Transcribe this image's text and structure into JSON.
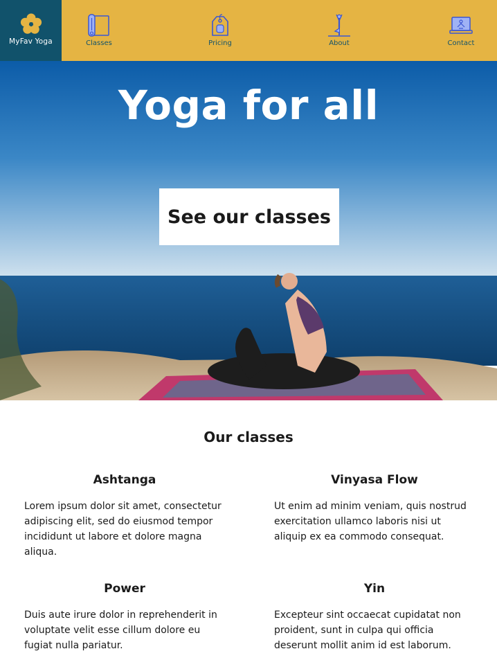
{
  "header": {
    "logo": {
      "text": "MyFav Yoga",
      "icon": "flower-icon"
    },
    "nav": [
      {
        "label": "Classes",
        "icon": "yoga-mat-icon"
      },
      {
        "label": "Pricing",
        "icon": "price-tag-icon"
      },
      {
        "label": "About",
        "icon": "tree-pose-icon"
      },
      {
        "label": "Contact",
        "icon": "laptop-icon"
      }
    ]
  },
  "hero": {
    "title": "Yoga for all",
    "cta_label": "See our classes"
  },
  "classes": {
    "title": "Our classes",
    "items": [
      {
        "name": "Ashtanga",
        "description": "Lorem ipsum dolor sit amet, consectetur adipiscing elit, sed do eiusmod tempor incididunt ut labore et dolore magna aliqua."
      },
      {
        "name": "Vinyasa Flow",
        "description": "Ut enim ad minim veniam, quis nostrud exercitation ullamco laboris nisi ut aliquip ex ea commodo consequat."
      },
      {
        "name": "Power",
        "description": "Duis aute irure dolor in reprehenderit in voluptate velit esse cillum dolore eu fugiat nulla pariatur."
      },
      {
        "name": "Yin",
        "description": "Excepteur sint occaecat cupidatat non proident, sunt in culpa qui officia deserunt mollit anim id est laborum."
      }
    ]
  },
  "colors": {
    "header_bg": "#e5b443",
    "logo_bg": "#11526b",
    "icon_stroke": "#3a56d4"
  }
}
